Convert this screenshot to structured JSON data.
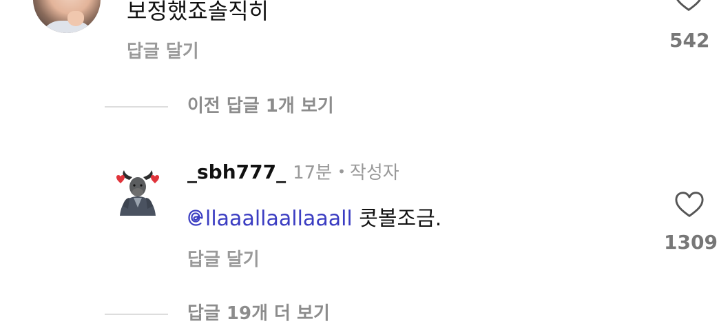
{
  "parent_comment": {
    "text": "보정했죠솔직히",
    "reply_label": "답글 달기",
    "like_count": "542"
  },
  "previous_replies_label": "이전 답글 1개 보기",
  "reply": {
    "username": "_sbh777_",
    "time": "17분",
    "separator": "•",
    "author_tag": "작성자",
    "mention": "llaaallaallaaall",
    "text": "콧볼조금.",
    "reply_label": "답글 달기",
    "like_count": "1309"
  },
  "more_replies_label": "답글 19개 더 보기",
  "colors": {
    "mention": "#3b3dc2",
    "muted": "#999999",
    "text": "#111111",
    "heart_outline": "#555555"
  },
  "icons": {
    "like": "heart-outline-icon",
    "mention": "threads-at-icon"
  }
}
